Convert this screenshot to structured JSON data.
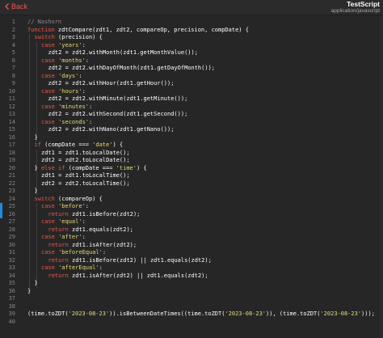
{
  "header": {
    "back_label": "Back",
    "title": "TestScript",
    "subtitle": "application/javascript"
  },
  "editor": {
    "lines": [
      {
        "n": "1",
        "indent": 0,
        "tokens": [
          {
            "t": "// Nashorn",
            "c": "cm"
          }
        ]
      },
      {
        "n": "2",
        "indent": 0,
        "tokens": [
          {
            "t": "function",
            "c": "kw"
          },
          {
            "t": " zdtCompare(zdt1, zdt2, compareOp, precision, compDate) {",
            "c": ""
          }
        ]
      },
      {
        "n": "3",
        "indent": 1,
        "tokens": [
          {
            "t": "switch",
            "c": "kw"
          },
          {
            "t": " (precision) {",
            "c": ""
          }
        ]
      },
      {
        "n": "4",
        "indent": 2,
        "tokens": [
          {
            "t": "case",
            "c": "kw"
          },
          {
            "t": " ",
            "c": ""
          },
          {
            "t": "'years'",
            "c": "str"
          },
          {
            "t": ":",
            "c": ""
          }
        ]
      },
      {
        "n": "5",
        "indent": 3,
        "tokens": [
          {
            "t": "zdt2 = zdt2.withMonth(zdt1.getMonthValue());",
            "c": ""
          }
        ]
      },
      {
        "n": "6",
        "indent": 2,
        "tokens": [
          {
            "t": "case",
            "c": "kw"
          },
          {
            "t": " ",
            "c": ""
          },
          {
            "t": "'months'",
            "c": "str"
          },
          {
            "t": ":",
            "c": ""
          }
        ]
      },
      {
        "n": "7",
        "indent": 3,
        "tokens": [
          {
            "t": "zdt2 = zdt2.withDayOfMonth(zdt1.getDayOfMonth());",
            "c": ""
          }
        ]
      },
      {
        "n": "8",
        "indent": 2,
        "tokens": [
          {
            "t": "case",
            "c": "kw"
          },
          {
            "t": " ",
            "c": ""
          },
          {
            "t": "'days'",
            "c": "str"
          },
          {
            "t": ":",
            "c": ""
          }
        ]
      },
      {
        "n": "9",
        "indent": 3,
        "tokens": [
          {
            "t": "zdt2 = zdt2.withHour(zdt1.getHour());",
            "c": ""
          }
        ]
      },
      {
        "n": "10",
        "indent": 2,
        "tokens": [
          {
            "t": "case",
            "c": "kw"
          },
          {
            "t": " ",
            "c": ""
          },
          {
            "t": "'hours'",
            "c": "str"
          },
          {
            "t": ":",
            "c": ""
          }
        ]
      },
      {
        "n": "11",
        "indent": 3,
        "tokens": [
          {
            "t": "zdt2 = zdt2.withMinute(zdt1.getMinute());",
            "c": ""
          }
        ]
      },
      {
        "n": "12",
        "indent": 2,
        "tokens": [
          {
            "t": "case",
            "c": "kw"
          },
          {
            "t": " ",
            "c": ""
          },
          {
            "t": "'minutes'",
            "c": "str"
          },
          {
            "t": ":",
            "c": ""
          }
        ]
      },
      {
        "n": "13",
        "indent": 3,
        "tokens": [
          {
            "t": "zdt2 = zdt2.withSecond(zdt1.getSecond());",
            "c": ""
          }
        ]
      },
      {
        "n": "14",
        "indent": 2,
        "tokens": [
          {
            "t": "case",
            "c": "kw"
          },
          {
            "t": " ",
            "c": ""
          },
          {
            "t": "'seconds'",
            "c": "str"
          },
          {
            "t": ":",
            "c": ""
          }
        ]
      },
      {
        "n": "15",
        "indent": 3,
        "tokens": [
          {
            "t": "zdt2 = zdt2.withNano(zdt1.getNano());",
            "c": ""
          }
        ]
      },
      {
        "n": "16",
        "indent": 1,
        "tokens": [
          {
            "t": "}",
            "c": ""
          }
        ]
      },
      {
        "n": "17",
        "indent": 1,
        "tokens": [
          {
            "t": "if",
            "c": "kw"
          },
          {
            "t": " (compDate === ",
            "c": ""
          },
          {
            "t": "'date'",
            "c": "str"
          },
          {
            "t": ") {",
            "c": ""
          }
        ]
      },
      {
        "n": "18",
        "indent": 2,
        "tokens": [
          {
            "t": "zdt1 = zdt1.toLocalDate();",
            "c": ""
          }
        ]
      },
      {
        "n": "19",
        "indent": 2,
        "tokens": [
          {
            "t": "zdt2 = zdt2.toLocalDate();",
            "c": ""
          }
        ]
      },
      {
        "n": "20",
        "indent": 1,
        "tokens": [
          {
            "t": "} ",
            "c": ""
          },
          {
            "t": "else if",
            "c": "kw"
          },
          {
            "t": " (compDate === ",
            "c": ""
          },
          {
            "t": "'time'",
            "c": "str"
          },
          {
            "t": ") {",
            "c": ""
          }
        ]
      },
      {
        "n": "21",
        "indent": 2,
        "tokens": [
          {
            "t": "zdt1 = zdt1.toLocalTime();",
            "c": ""
          }
        ]
      },
      {
        "n": "22",
        "indent": 2,
        "tokens": [
          {
            "t": "zdt2 = zdt2.toLocalTime();",
            "c": ""
          }
        ]
      },
      {
        "n": "23",
        "indent": 1,
        "tokens": [
          {
            "t": "}",
            "c": ""
          }
        ]
      },
      {
        "n": "24",
        "indent": 1,
        "tokens": [
          {
            "t": "switch",
            "c": "kw"
          },
          {
            "t": " (compareOp) {",
            "c": ""
          }
        ]
      },
      {
        "n": "25",
        "indent": 2,
        "tokens": [
          {
            "t": "case",
            "c": "kw"
          },
          {
            "t": " ",
            "c": ""
          },
          {
            "t": "'before'",
            "c": "str"
          },
          {
            "t": ":",
            "c": ""
          }
        ]
      },
      {
        "n": "26",
        "indent": 3,
        "tokens": [
          {
            "t": "return",
            "c": "kw"
          },
          {
            "t": " zdt1.isBefore(zdt2);",
            "c": ""
          }
        ]
      },
      {
        "n": "27",
        "indent": 2,
        "tokens": [
          {
            "t": "case",
            "c": "kw"
          },
          {
            "t": " ",
            "c": ""
          },
          {
            "t": "'equal'",
            "c": "str"
          },
          {
            "t": ":",
            "c": ""
          }
        ]
      },
      {
        "n": "28",
        "indent": 3,
        "tokens": [
          {
            "t": "return",
            "c": "kw"
          },
          {
            "t": " zdt1.equals(zdt2);",
            "c": ""
          }
        ]
      },
      {
        "n": "29",
        "indent": 2,
        "tokens": [
          {
            "t": "case",
            "c": "kw"
          },
          {
            "t": " ",
            "c": ""
          },
          {
            "t": "'after'",
            "c": "str"
          },
          {
            "t": ":",
            "c": ""
          }
        ]
      },
      {
        "n": "30",
        "indent": 3,
        "tokens": [
          {
            "t": "return",
            "c": "kw"
          },
          {
            "t": " zdt1.isAfter(zdt2);",
            "c": ""
          }
        ]
      },
      {
        "n": "31",
        "indent": 2,
        "tokens": [
          {
            "t": "case",
            "c": "kw"
          },
          {
            "t": " ",
            "c": ""
          },
          {
            "t": "'beforeEqual'",
            "c": "str"
          },
          {
            "t": ":",
            "c": ""
          }
        ]
      },
      {
        "n": "32",
        "indent": 3,
        "tokens": [
          {
            "t": "return",
            "c": "kw"
          },
          {
            "t": " zdt1.isBefore(zdt2) || zdt1.equals(zdt2);",
            "c": ""
          }
        ]
      },
      {
        "n": "33",
        "indent": 2,
        "tokens": [
          {
            "t": "case",
            "c": "kw"
          },
          {
            "t": " ",
            "c": ""
          },
          {
            "t": "'afterEqual'",
            "c": "str"
          },
          {
            "t": ":",
            "c": ""
          }
        ]
      },
      {
        "n": "34",
        "indent": 3,
        "tokens": [
          {
            "t": "return",
            "c": "kw"
          },
          {
            "t": " zdt1.isAfter(zdt2) || zdt1.equals(zdt2);",
            "c": ""
          }
        ]
      },
      {
        "n": "35",
        "indent": 1,
        "tokens": [
          {
            "t": "}",
            "c": ""
          }
        ]
      },
      {
        "n": "36",
        "indent": 0,
        "tokens": [
          {
            "t": "}",
            "c": ""
          }
        ]
      },
      {
        "n": "37",
        "indent": 0,
        "tokens": []
      },
      {
        "n": "38",
        "indent": 0,
        "tokens": []
      },
      {
        "n": "39",
        "indent": 0,
        "tokens": [
          {
            "t": "(time.toZDT(",
            "c": ""
          },
          {
            "t": "'2023-08-23'",
            "c": "str"
          },
          {
            "t": ")).isBetweenDateTimes((time.toZDT(",
            "c": ""
          },
          {
            "t": "'2023-08-23'",
            "c": "str"
          },
          {
            "t": ")), (time.toZDT(",
            "c": ""
          },
          {
            "t": "'2023-08-23'",
            "c": "str"
          },
          {
            "t": ")));",
            "c": ""
          }
        ]
      },
      {
        "n": "40",
        "indent": 0,
        "tokens": []
      }
    ]
  },
  "colors": {
    "keyword": "#e8584a",
    "string": "#e6db74",
    "comment": "#8a8a8a",
    "text": "#ffffff",
    "line_number": "#858585",
    "background": "#262626",
    "gutter_marker": "#1e8bd6",
    "back_link": "#e8584a"
  }
}
